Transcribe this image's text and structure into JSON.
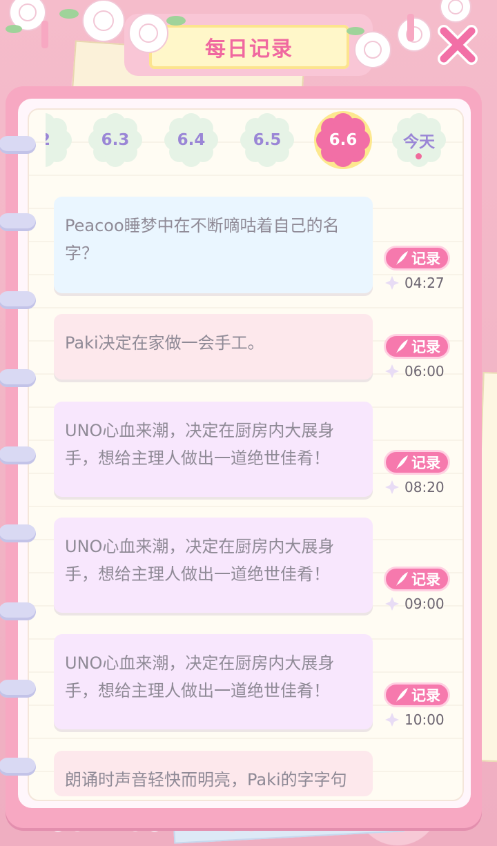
{
  "title": "每日记录",
  "close_icon": "close-icon",
  "dates": [
    {
      "label": "2",
      "selected": false
    },
    {
      "label": "6.3",
      "selected": false
    },
    {
      "label": "6.4",
      "selected": false
    },
    {
      "label": "6.5",
      "selected": false
    },
    {
      "label": "6.6",
      "selected": true
    },
    {
      "label": "今天",
      "selected": false
    }
  ],
  "entries": [
    {
      "text": "Peacoo睡梦中在不断嘀咕着自己的名字？",
      "record_label": "记录",
      "time": "04:27",
      "color": "#eaf6ff"
    },
    {
      "text": "Paki决定在家做一会手工。",
      "record_label": "记录",
      "time": "06:00",
      "color": "#fde8ec"
    },
    {
      "text": "UNO心血来潮，决定在厨房内大展身手，想给主理人做出一道绝世佳肴！",
      "record_label": "记录",
      "time": "08:20",
      "color": "#f8e7fd"
    },
    {
      "text": "UNO心血来潮，决定在厨房内大展身手，想给主理人做出一道绝世佳肴！",
      "record_label": "记录",
      "time": "09:00",
      "color": "#f8e7fd"
    },
    {
      "text": "UNO心血来潮，决定在厨房内大展身手，想给主理人做出一道绝世佳肴！",
      "record_label": "记录",
      "time": "10:00",
      "color": "#f8e7fd"
    },
    {
      "text": "朗诵时声音轻快而明亮，Paki的字字句句",
      "record_label": "",
      "time": "",
      "color": "#fde8ec"
    }
  ],
  "colors": {
    "accent": "#f06a9c",
    "tab_label": "#9a86d6",
    "tab_bg": "#e6f3e6",
    "tab_selected_bg": "#f26fa6"
  }
}
